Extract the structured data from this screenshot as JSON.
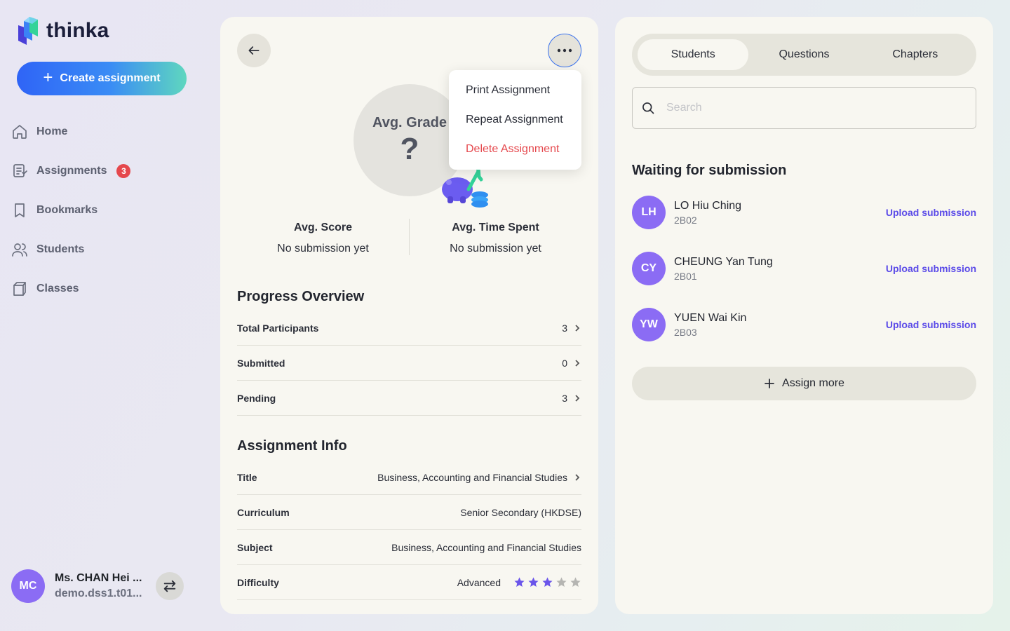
{
  "brand": {
    "name": "thinka"
  },
  "sidebar": {
    "create_label": "Create assignment",
    "nav": [
      {
        "label": "Home",
        "icon": "home-icon"
      },
      {
        "label": "Assignments",
        "icon": "assignments-icon",
        "badge": "3"
      },
      {
        "label": "Bookmarks",
        "icon": "bookmark-icon"
      },
      {
        "label": "Students",
        "icon": "students-icon"
      },
      {
        "label": "Classes",
        "icon": "classes-icon"
      }
    ],
    "profile": {
      "initials": "MC",
      "name": "Ms. CHAN Hei ...",
      "email": "demo.dss1.t01..."
    }
  },
  "summary": {
    "avg_grade_label": "Avg. Grade",
    "avg_grade_value": "?",
    "avg_score_label": "Avg. Score",
    "avg_score_value": "No submission yet",
    "avg_time_label": "Avg. Time Spent",
    "avg_time_value": "No submission yet"
  },
  "menu": {
    "items": [
      {
        "label": "Print Assignment",
        "danger": false
      },
      {
        "label": "Repeat Assignment",
        "danger": false
      },
      {
        "label": "Delete Assignment",
        "danger": true
      }
    ]
  },
  "progress": {
    "title": "Progress Overview",
    "rows": [
      {
        "label": "Total Participants",
        "value": "3"
      },
      {
        "label": "Submitted",
        "value": "0"
      },
      {
        "label": "Pending",
        "value": "3"
      }
    ]
  },
  "info": {
    "title": "Assignment Info",
    "rows": [
      {
        "label": "Title",
        "value": "Business, Accounting and Financial Studies"
      },
      {
        "label": "Curriculum",
        "value": "Senior Secondary (HKDSE)"
      },
      {
        "label": "Subject",
        "value": "Business, Accounting and Financial Studies"
      },
      {
        "label": "Difficulty",
        "value": "Advanced",
        "rating": 3,
        "max_rating": 5
      }
    ]
  },
  "right": {
    "tabs": [
      "Students",
      "Questions",
      "Chapters"
    ],
    "active_tab": "Students",
    "search_placeholder": "Search",
    "waiting_title": "Waiting for submission",
    "upload_label": "Upload submission",
    "students": [
      {
        "initials": "LH",
        "name": "LO Hiu Ching",
        "class": "2B02"
      },
      {
        "initials": "CY",
        "name": "CHEUNG Yan Tung",
        "class": "2B01"
      },
      {
        "initials": "YW",
        "name": "YUEN Wai Kin",
        "class": "2B03"
      }
    ],
    "assign_more_label": "Assign more"
  },
  "colors": {
    "accent": "#5b4be8",
    "avatar": "#8b6cf4",
    "danger": "#e5484d",
    "star_filled": "#6a55ea",
    "star_empty": "#b5b5b2"
  }
}
